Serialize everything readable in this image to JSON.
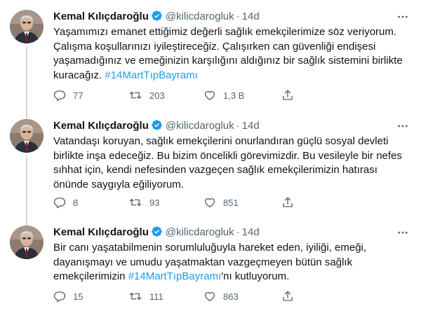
{
  "author": {
    "name": "Kemal Kılıçdaroğlu",
    "handle": "@kilicdarogluk",
    "verified": true
  },
  "tweets": [
    {
      "time": "14d",
      "text": "Yaşamımızı emanet ettiğimiz değerli sağlık emekçilerimize söz veriyorum. Çalışma koşullarınızı iyileştireceğiz. Çalışırken can güvenliği endişesi yaşamadığınız ve emeğinizin karşılığını aldığınız bir sağlık sistemini birlikte kuracağız. ",
      "hashtag": "#14MartTıpBayramı",
      "text_after": "",
      "replies": "77",
      "retweets": "203",
      "likes": "1,3 B"
    },
    {
      "time": "14d",
      "text": "Vatandaşı koruyan, sağlık emekçilerini onurlandıran güçlü sosyal devleti birlikte inşa edeceğiz. Bu bizim öncelikli görevimizdir. Bu vesileyle bir nefes sıhhat için, kendi nefesinden vazgeçen sağlık emekçilerimizin hatırası önünde saygıyla eğiliyorum.",
      "hashtag": "",
      "text_after": "",
      "replies": "8",
      "retweets": "93",
      "likes": "851"
    },
    {
      "time": "14d",
      "text": "Bir canı yaşatabilmenin sorumluluğuyla hareket eden, iyiliği, emeği, dayanışmayı ve umudu yaşatmaktan vazgeçmeyen bütün sağlık emekçilerimizin ",
      "hashtag": "#14MartTıpBayramı",
      "text_after": "'nı kutluyorum.",
      "replies": "15",
      "retweets": "111",
      "likes": "863"
    }
  ],
  "separator": "·",
  "colors": {
    "text": "#0f1419",
    "secondary": "#536471",
    "hashtag": "#1d9bf0",
    "verified": "#1d9bf0",
    "thread_line": "#cfd9de"
  },
  "icons": {
    "reply": "speech-bubble",
    "retweet": "retweet-arrows",
    "like": "heart-outline",
    "share": "share-upload",
    "more": "three-dots"
  }
}
